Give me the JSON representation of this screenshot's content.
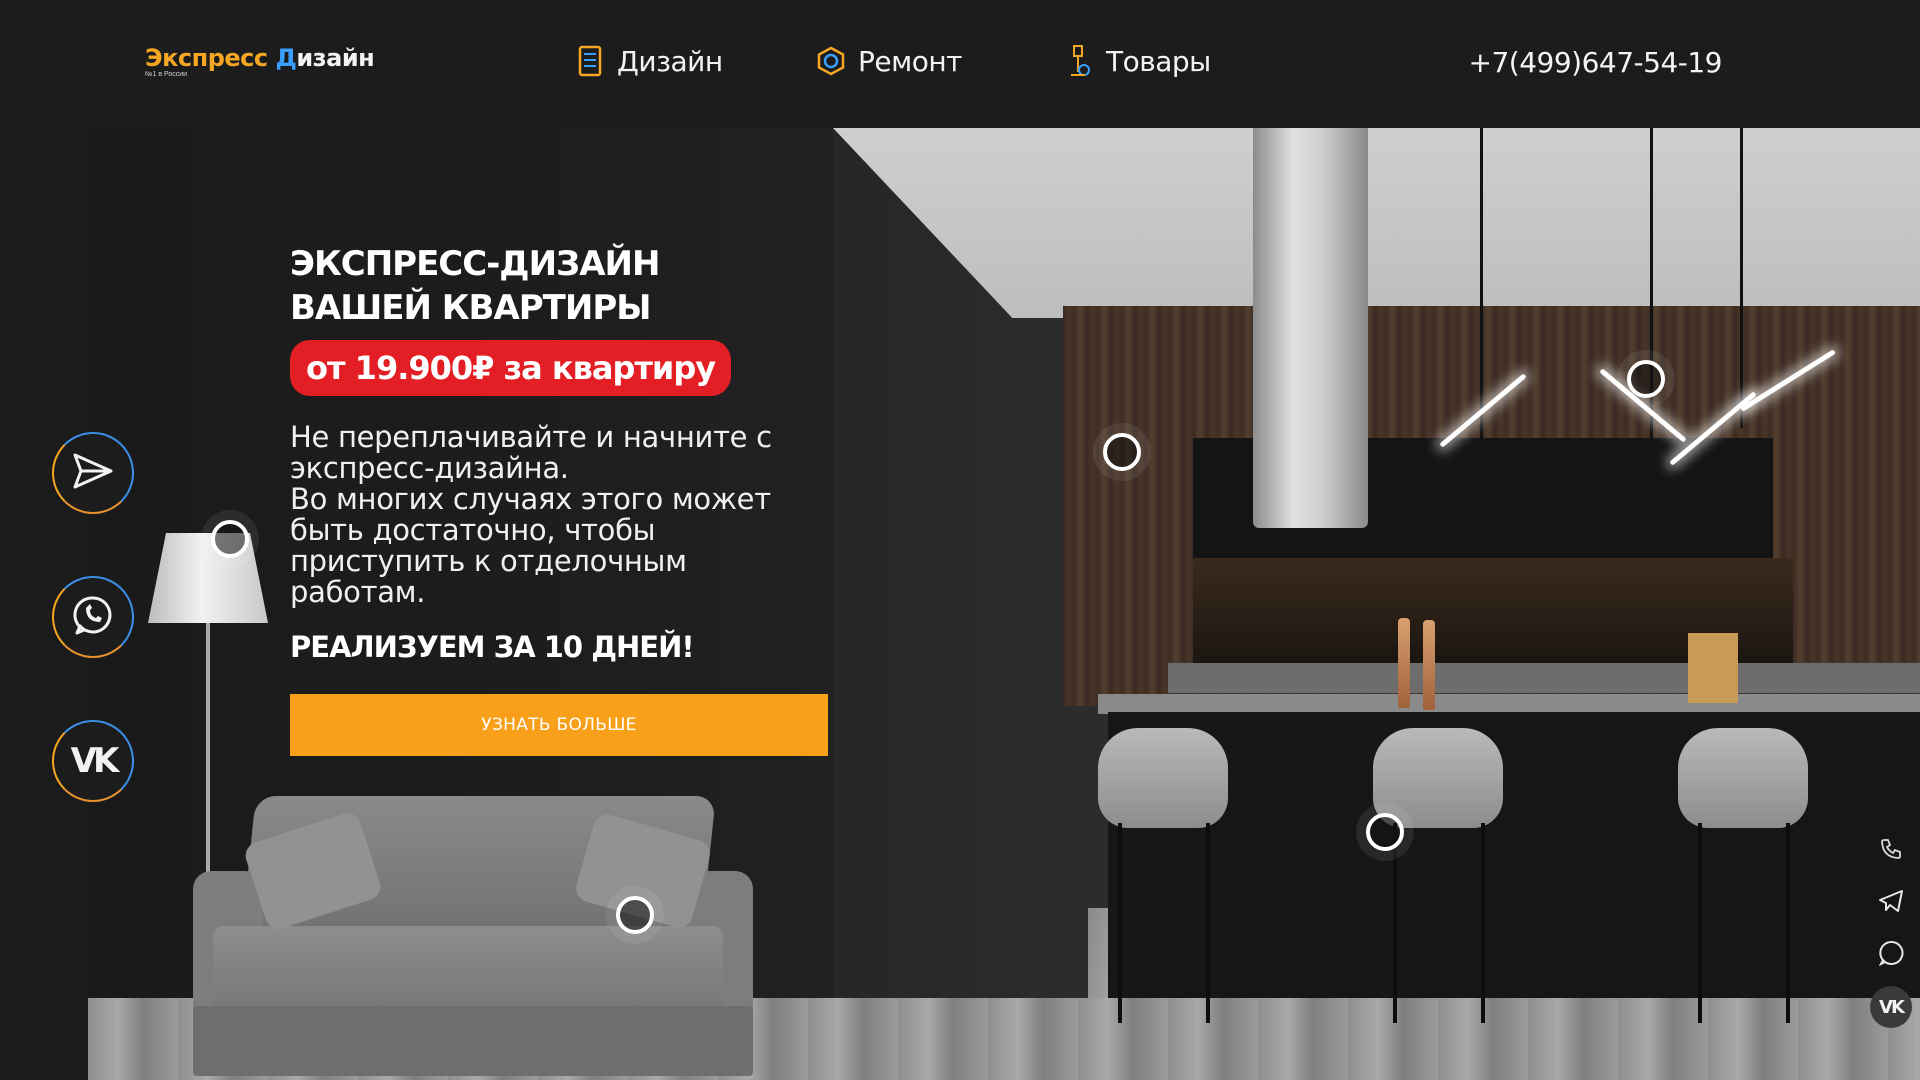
{
  "header": {
    "logo": {
      "part1": "Экспресс ",
      "accent_letter": "Д",
      "part2": "изайн",
      "subtitle": "№1 в России"
    },
    "nav": [
      {
        "label": "Дизайн",
        "icon": "document-icon"
      },
      {
        "label": "Ремонт",
        "icon": "hexagon-icon"
      },
      {
        "label": "Товары",
        "icon": "lamp-icon"
      }
    ],
    "phone": "+7(499)647-54-19"
  },
  "hero": {
    "title": "ЭКСПРЕСС-ДИЗАЙН\nВАШЕЙ КВАРТИРЫ",
    "price_badge": "от 19.900₽ за квартиру",
    "description": "Не переплачивайте и начните с экспресс-дизайна.\nВо многих случаях этого может быть достаточно, чтобы приступить к отделочным работам.",
    "tagline": "РЕАЛИЗУЕМ ЗА 10 ДНЕЙ!",
    "cta_label": "УЗНАТЬ БОЛЬШЕ"
  },
  "social_left": [
    {
      "icon": "telegram-icon"
    },
    {
      "icon": "whatsapp-icon"
    },
    {
      "icon": "vk-icon"
    }
  ],
  "floating_right": [
    {
      "icon": "phone-icon"
    },
    {
      "icon": "telegram-icon"
    },
    {
      "icon": "whatsapp-icon"
    },
    {
      "icon": "vk-icon"
    }
  ],
  "colors": {
    "accent_orange": "#f9a01b",
    "badge_red": "#e31e24",
    "background": "#1b1b1c",
    "ring_blue": "#3b8fe8"
  }
}
